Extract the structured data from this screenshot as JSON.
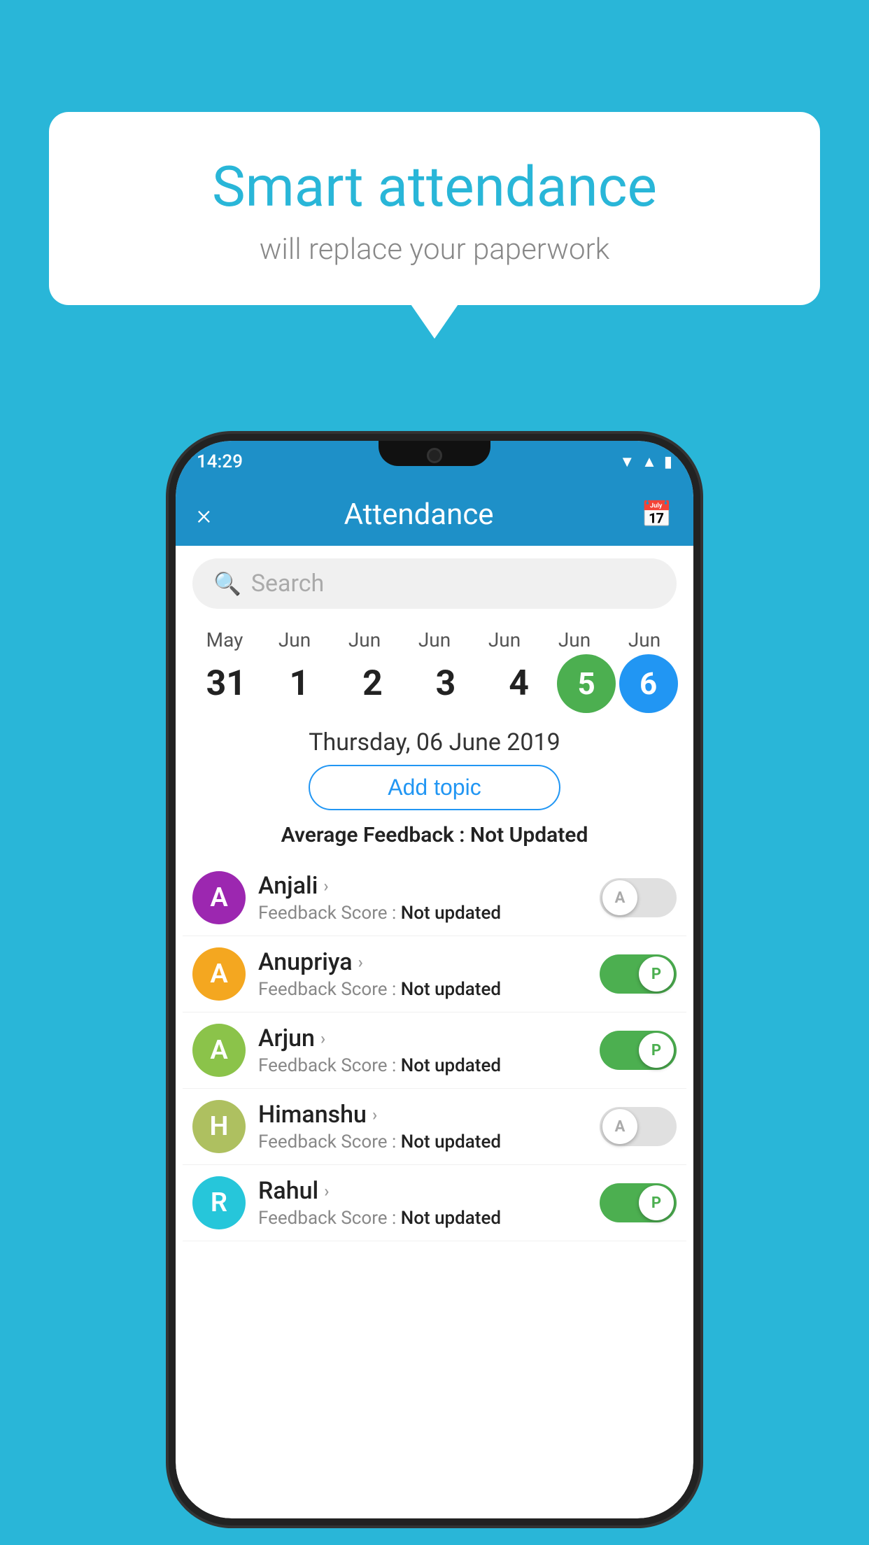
{
  "background": {
    "color": "#29b6d8"
  },
  "speech_bubble": {
    "title": "Smart attendance",
    "subtitle": "will replace your paperwork"
  },
  "phone": {
    "status_bar": {
      "time": "14:29"
    },
    "app_bar": {
      "title": "Attendance",
      "close_label": "×",
      "calendar_icon": "📅"
    },
    "search": {
      "placeholder": "Search"
    },
    "calendar": {
      "months": [
        "May",
        "Jun",
        "Jun",
        "Jun",
        "Jun",
        "Jun",
        "Jun"
      ],
      "days": [
        "31",
        "1",
        "2",
        "3",
        "4",
        "5",
        "6"
      ],
      "today_index": 5,
      "selected_index": 6
    },
    "selected_date": "Thursday, 06 June 2019",
    "add_topic_label": "Add topic",
    "avg_feedback_label": "Average Feedback : ",
    "avg_feedback_value": "Not Updated",
    "students": [
      {
        "name": "Anjali",
        "avatar_letter": "A",
        "avatar_color": "#9c27b0",
        "feedback_label": "Feedback Score : ",
        "feedback_value": "Not updated",
        "toggle": "off",
        "toggle_letter": "A"
      },
      {
        "name": "Anupriya",
        "avatar_letter": "A",
        "avatar_color": "#f4a720",
        "feedback_label": "Feedback Score : ",
        "feedback_value": "Not updated",
        "toggle": "on",
        "toggle_letter": "P"
      },
      {
        "name": "Arjun",
        "avatar_letter": "A",
        "avatar_color": "#8bc34a",
        "feedback_label": "Feedback Score : ",
        "feedback_value": "Not updated",
        "toggle": "on",
        "toggle_letter": "P"
      },
      {
        "name": "Himanshu",
        "avatar_letter": "H",
        "avatar_color": "#aec060",
        "feedback_label": "Feedback Score : ",
        "feedback_value": "Not updated",
        "toggle": "off",
        "toggle_letter": "A"
      },
      {
        "name": "Rahul",
        "avatar_letter": "R",
        "avatar_color": "#26c6da",
        "feedback_label": "Feedback Score : ",
        "feedback_value": "Not updated",
        "toggle": "on",
        "toggle_letter": "P"
      }
    ]
  }
}
